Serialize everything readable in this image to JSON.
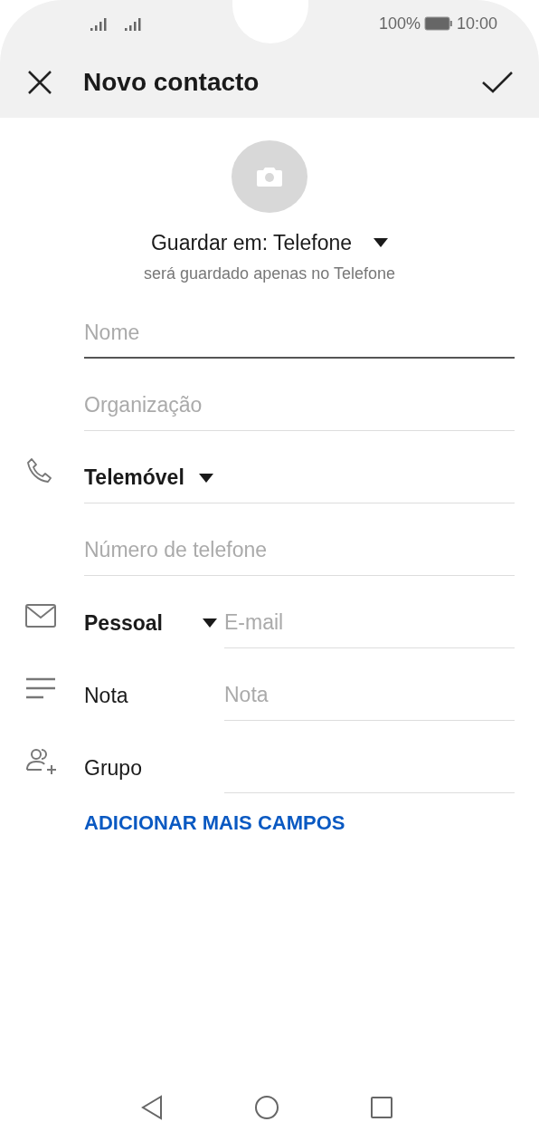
{
  "status_bar": {
    "battery": "100%",
    "time": "10:00"
  },
  "header": {
    "title": "Novo contacto"
  },
  "storage": {
    "label": "Guardar em: Telefone",
    "note": "será guardado apenas no Telefone"
  },
  "fields": [
    {
      "kind": "input",
      "placeholder": "Nome",
      "focused": true
    },
    {
      "kind": "input",
      "placeholder": "Organização",
      "focused": false
    },
    {
      "kind": "phone-type",
      "label": "Telemóvel"
    },
    {
      "kind": "input",
      "placeholder": "Número de telefone",
      "focused": false
    },
    {
      "kind": "email",
      "label": "Pessoal",
      "placeholder": "E-mail"
    },
    {
      "kind": "note",
      "label": "Nota",
      "placeholder": "Nota"
    },
    {
      "kind": "group",
      "label": "Grupo"
    }
  ],
  "add_fields_link": "ADICIONAR MAIS CAMPOS"
}
